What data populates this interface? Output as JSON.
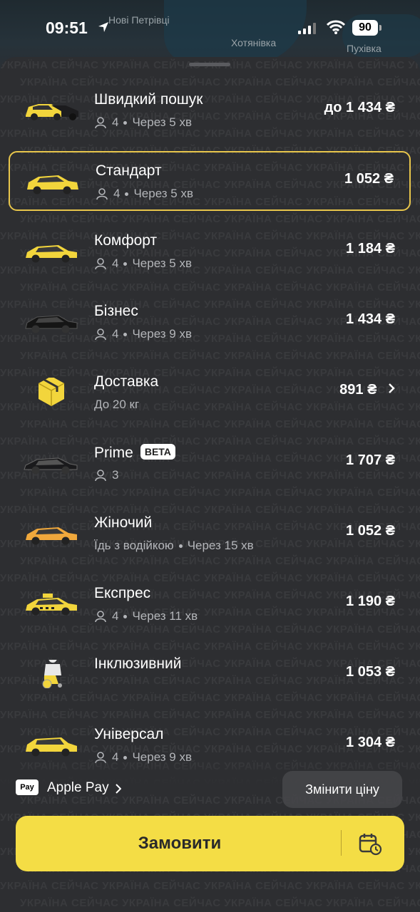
{
  "status_bar": {
    "time": "09:51",
    "battery": "90"
  },
  "map": {
    "labels": [
      "Нові Петрівці",
      "Хотянівка",
      "Пухівка"
    ]
  },
  "watermark_text": "УКРАЇНА СЕЙЧАС",
  "tariffs": [
    {
      "name": "Швидкий пошук",
      "seats": "4",
      "eta": "Через 5 хв",
      "price": "до 1 434 ₴",
      "icon": "car-yellow-black-icon"
    },
    {
      "name": "Стандарт",
      "seats": "4",
      "eta": "Через 5 хв",
      "price": "1 052 ₴",
      "icon": "car-yellow-icon",
      "selected": true
    },
    {
      "name": "Комфорт",
      "seats": "4",
      "eta": "Через 5 хв",
      "price": "1 184 ₴",
      "icon": "car-yellow-icon"
    },
    {
      "name": "Бізнес",
      "seats": "4",
      "eta": "Через 9 хв",
      "price": "1 434 ₴",
      "icon": "car-black-icon"
    },
    {
      "name": "Доставка",
      "sub": "До 20 кг",
      "price": "891 ₴",
      "icon": "box-icon"
    },
    {
      "name": "Prime",
      "badge": "BETA",
      "seats": "3",
      "price": "1 707 ₴",
      "icon": "car-black-icon"
    },
    {
      "name": "Жіночий",
      "sub": "Їдь з водійкою",
      "eta": "Через 15 хв",
      "price": "1 052 ₴",
      "icon": "car-orange-icon"
    },
    {
      "name": "Експрес",
      "seats": "4",
      "eta": "Через 11 хв",
      "price": "1 190 ₴",
      "icon": "taxi-icon"
    },
    {
      "name": "Інклюзивний",
      "price": "1 053 ₴",
      "icon": "wheelchair-person-icon"
    },
    {
      "name": "Універсал",
      "seats": "4",
      "eta": "Через 9 хв",
      "price": "1 304 ₴",
      "icon": "car-yellow-icon"
    }
  ],
  "payment": {
    "logo": " Pay",
    "label": "Apple Pay"
  },
  "change_price_label": "Змінити ціну",
  "order_label": "Замовити",
  "colors": {
    "accent": "#f4dd45",
    "selected_border": "#e8c64b",
    "sheet_bg": "#2d2e31"
  }
}
